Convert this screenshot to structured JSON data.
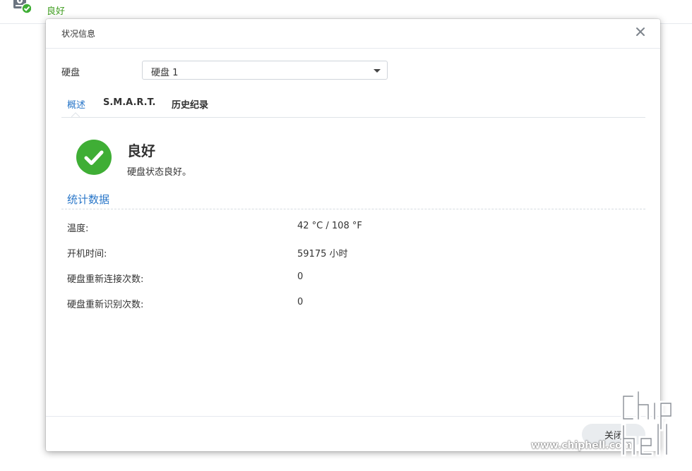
{
  "background": {
    "status_text": "良好"
  },
  "dialog": {
    "title": "状况信息",
    "disk_label": "硬盘",
    "disk_select": {
      "value": "硬盘 1"
    },
    "tabs": [
      {
        "label": "概述",
        "active": true
      },
      {
        "label": "S.M.A.R.T.",
        "active": false
      },
      {
        "label": "历史纪录",
        "active": false
      }
    ],
    "status": {
      "title": "良好",
      "description": "硬盘状态良好。"
    },
    "stats": {
      "section_title": "统计数据",
      "rows": [
        {
          "label": "温度:",
          "value": "42 °C / 108 °F"
        },
        {
          "label": "开机时间:",
          "value": "59175 小时"
        },
        {
          "label": "硬盘重新连接次数:",
          "value": "0"
        },
        {
          "label": "硬盘重新识别次数:",
          "value": "0"
        }
      ]
    },
    "close_button": "关闭"
  },
  "watermark": {
    "url": "www.chiphell.com",
    "logo_text": "chip hell"
  },
  "colors": {
    "accent": "#2a77c9",
    "ok_green": "#3fae35",
    "status_text_green": "#3f9d1f"
  },
  "icons": {
    "disk": "disk-icon",
    "ok": "check-circle-icon",
    "close": "close-icon",
    "dropdown": "caret-down-icon"
  }
}
